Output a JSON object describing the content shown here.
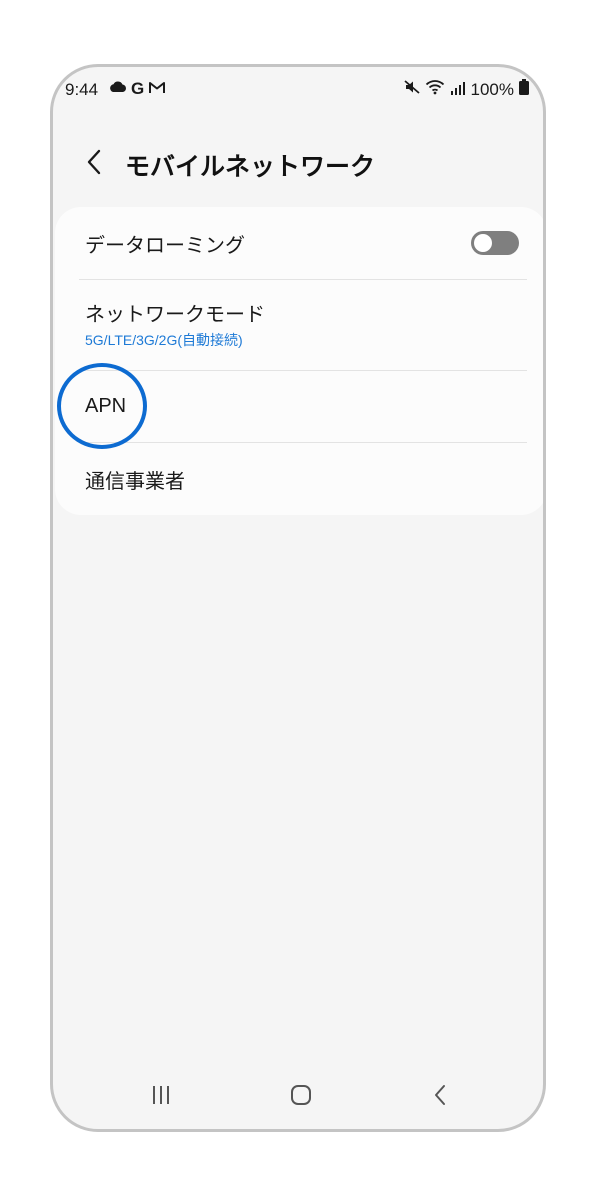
{
  "status_bar": {
    "time": "9:44",
    "left_icons": [
      "cloud-icon",
      "google-icon",
      "gmail-icon"
    ],
    "google_glyph": "G",
    "right_icons": [
      "mute-icon",
      "wifi-icon",
      "signal-icon",
      "battery-icon"
    ],
    "battery": "100%"
  },
  "header": {
    "back_icon": "chevron-left-icon",
    "title": "モバイルネットワーク"
  },
  "settings": {
    "data_roaming": {
      "title": "データローミング",
      "enabled": false
    },
    "network_mode": {
      "title": "ネットワークモード",
      "value": "5G/LTE/3G/2G(自動接続)"
    },
    "apn": {
      "title": "APN",
      "highlighted": true
    },
    "carrier": {
      "title": "通信事業者"
    }
  },
  "nav_bar": {
    "items": [
      "recent-apps-icon",
      "home-icon",
      "back-icon"
    ]
  },
  "colors": {
    "accent": "#1e7ad6",
    "highlight": "#0d6bd1",
    "toggle_off": "#7f7f7f",
    "background": "#f5f5f5",
    "card": "#fcfcfc"
  }
}
